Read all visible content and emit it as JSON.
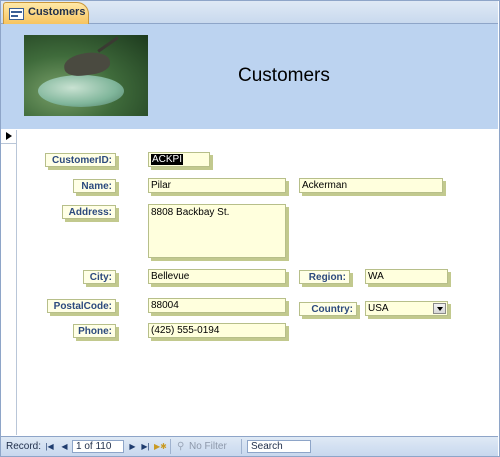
{
  "tab": {
    "title": "Customers",
    "icon": "form-icon"
  },
  "header": {
    "title": "Customers",
    "image": "frog-on-dish-photo"
  },
  "fields": {
    "customer_id": {
      "label": "CustomerID:",
      "value": "ACKPI"
    },
    "name": {
      "label": "Name:",
      "first": "Pilar",
      "last": "Ackerman"
    },
    "address": {
      "label": "Address:",
      "value": "8808 Backbay St."
    },
    "city": {
      "label": "City:",
      "value": "Bellevue"
    },
    "region": {
      "label": "Region:",
      "value": "WA"
    },
    "postal_code": {
      "label": "PostalCode:",
      "value": "88004"
    },
    "country": {
      "label": "Country:",
      "value": "USA"
    },
    "phone": {
      "label": "Phone:",
      "value": "(425) 555-0194"
    }
  },
  "navigation": {
    "record_label": "Record:",
    "position": "1 of 110",
    "first_icon": "first-record-icon",
    "prev_icon": "previous-record-icon",
    "next_icon": "next-record-icon",
    "last_icon": "last-record-icon",
    "new_icon": "new-record-icon",
    "filter_label": "No Filter",
    "search_placeholder": "Search"
  },
  "colors": {
    "header_bg": "#bcd3f0",
    "field_bg": "#ffffdd",
    "label_text": "#2c4a7e",
    "tab_bg": "#f7c45f"
  }
}
